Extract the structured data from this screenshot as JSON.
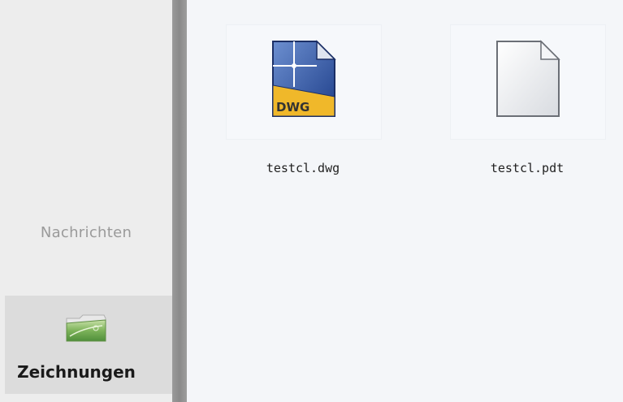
{
  "sidebar": {
    "items": [
      {
        "label": "Nachrichten",
        "icon": "none"
      },
      {
        "label": "Zeichnungen",
        "icon": "folder-drawings-icon"
      }
    ]
  },
  "files": [
    {
      "name": "testcl.dwg",
      "icon": "dwg-file-icon",
      "icon_label": "DWG"
    },
    {
      "name": "testcl.pdt",
      "icon": "generic-file-icon"
    }
  ],
  "colors": {
    "sidebar_bg": "#ededed",
    "active_item_bg": "#dcdcdc",
    "content_bg": "#f4f6f9",
    "dwg_blue": "#2b4f9e",
    "dwg_yellow": "#f0b82a"
  }
}
